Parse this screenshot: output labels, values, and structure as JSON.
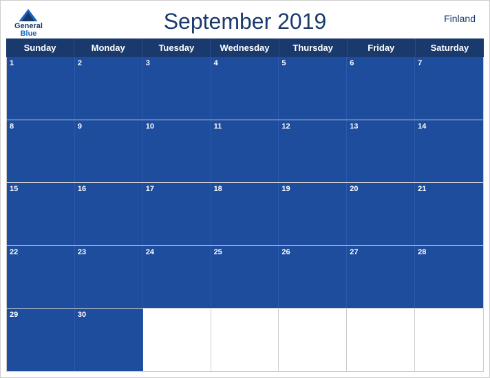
{
  "header": {
    "title": "September 2019",
    "country": "Finland",
    "logo": {
      "line1": "General",
      "line2": "Blue"
    }
  },
  "dayHeaders": [
    "Sunday",
    "Monday",
    "Tuesday",
    "Wednesday",
    "Thursday",
    "Friday",
    "Saturday"
  ],
  "weeks": [
    [
      {
        "date": "1",
        "hasHeader": true
      },
      {
        "date": "2",
        "hasHeader": true
      },
      {
        "date": "3",
        "hasHeader": true
      },
      {
        "date": "4",
        "hasHeader": true
      },
      {
        "date": "5",
        "hasHeader": true
      },
      {
        "date": "6",
        "hasHeader": true
      },
      {
        "date": "7",
        "hasHeader": true
      }
    ],
    [
      {
        "date": "8",
        "hasHeader": true
      },
      {
        "date": "9",
        "hasHeader": true
      },
      {
        "date": "10",
        "hasHeader": true
      },
      {
        "date": "11",
        "hasHeader": true
      },
      {
        "date": "12",
        "hasHeader": true
      },
      {
        "date": "13",
        "hasHeader": true
      },
      {
        "date": "14",
        "hasHeader": true
      }
    ],
    [
      {
        "date": "15",
        "hasHeader": true
      },
      {
        "date": "16",
        "hasHeader": true
      },
      {
        "date": "17",
        "hasHeader": true
      },
      {
        "date": "18",
        "hasHeader": true
      },
      {
        "date": "19",
        "hasHeader": true
      },
      {
        "date": "20",
        "hasHeader": true
      },
      {
        "date": "21",
        "hasHeader": true
      }
    ],
    [
      {
        "date": "22",
        "hasHeader": true
      },
      {
        "date": "23",
        "hasHeader": true
      },
      {
        "date": "24",
        "hasHeader": true
      },
      {
        "date": "25",
        "hasHeader": true
      },
      {
        "date": "26",
        "hasHeader": true
      },
      {
        "date": "27",
        "hasHeader": true
      },
      {
        "date": "28",
        "hasHeader": true
      }
    ],
    [
      {
        "date": "29",
        "hasHeader": true
      },
      {
        "date": "30",
        "hasHeader": true
      },
      {
        "date": "",
        "hasHeader": false
      },
      {
        "date": "",
        "hasHeader": false
      },
      {
        "date": "",
        "hasHeader": false
      },
      {
        "date": "",
        "hasHeader": false
      },
      {
        "date": "",
        "hasHeader": false
      }
    ]
  ]
}
